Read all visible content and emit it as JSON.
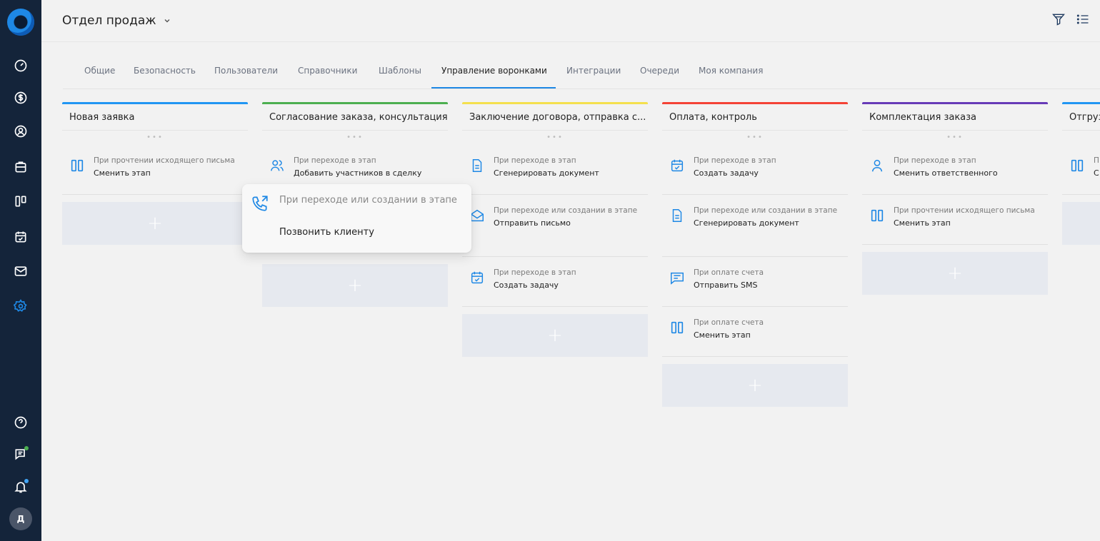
{
  "header": {
    "title": "Отдел продаж"
  },
  "rail": {
    "avatar_letter": "Д"
  },
  "tabs": [
    {
      "label": "Общие",
      "active": false
    },
    {
      "label": "Безопасность",
      "active": false
    },
    {
      "label": "Пользователи",
      "active": false
    },
    {
      "label": "Справочники",
      "active": false
    },
    {
      "label": "Шаблоны",
      "active": false
    },
    {
      "label": "Управление воронками",
      "active": true
    },
    {
      "label": "Интеграции",
      "active": false
    },
    {
      "label": "Очереди",
      "active": false
    },
    {
      "label": "Моя компания",
      "active": false
    }
  ],
  "columns": [
    {
      "title": "Новая заявка",
      "color": "#2196f3",
      "cards": [
        {
          "icon": "kanban-icon",
          "trigger": "При прочтении исходящего письма",
          "action": "Сменить этап"
        }
      ]
    },
    {
      "title": "Согласование заказа, консультация",
      "color": "#4caf50",
      "cards": [
        {
          "icon": "users-icon",
          "trigger": "При переходе в этап",
          "action": "Добавить участников в сделку"
        }
      ]
    },
    {
      "title": "Заключение договора, отправка с...",
      "color": "#f4e04d",
      "cards": [
        {
          "icon": "document-icon",
          "trigger": "При переходе в этап",
          "action": "Сгенерировать документ"
        },
        {
          "icon": "mail-open-icon",
          "trigger": "При переходе или создании в этапе",
          "action": "Отправить письмо"
        },
        {
          "icon": "calendar-check-icon",
          "trigger": "При переходе в этап",
          "action": "Создать задачу"
        }
      ]
    },
    {
      "title": "Оплата, контроль",
      "color": "#f44336",
      "cards": [
        {
          "icon": "calendar-check-icon",
          "trigger": "При переходе в этап",
          "action": "Создать задачу"
        },
        {
          "icon": "document-icon",
          "trigger": "При переходе или создании в этапе",
          "action": "Сгенерировать документ"
        },
        {
          "icon": "sms-icon",
          "trigger": "При оплате счета",
          "action": "Отправить SMS"
        },
        {
          "icon": "kanban-icon",
          "trigger": "При оплате счета",
          "action": "Сменить этап"
        }
      ]
    },
    {
      "title": "Комплектация заказа",
      "color": "#673ab7",
      "cards": [
        {
          "icon": "user-icon",
          "trigger": "При переходе в этап",
          "action": "Сменить ответственного"
        },
        {
          "icon": "kanban-icon",
          "trigger": "При прочтении исходящего письма",
          "action": "Сменить этап"
        }
      ]
    },
    {
      "title": "Отгруз",
      "color": "#2196f3",
      "cards": [
        {
          "icon": "kanban-icon",
          "trigger": "П",
          "action": "С"
        }
      ]
    }
  ],
  "popup": {
    "icon": "phone-call-icon",
    "trigger": "При переходе или создании в этапе",
    "action": "Позвонить клиенту"
  },
  "add_symbol": "+",
  "dots_symbol": "•••",
  "colors": {
    "accent": "#1e88e5",
    "rail": "#14243a",
    "icon_blue": "#1e88e5"
  }
}
